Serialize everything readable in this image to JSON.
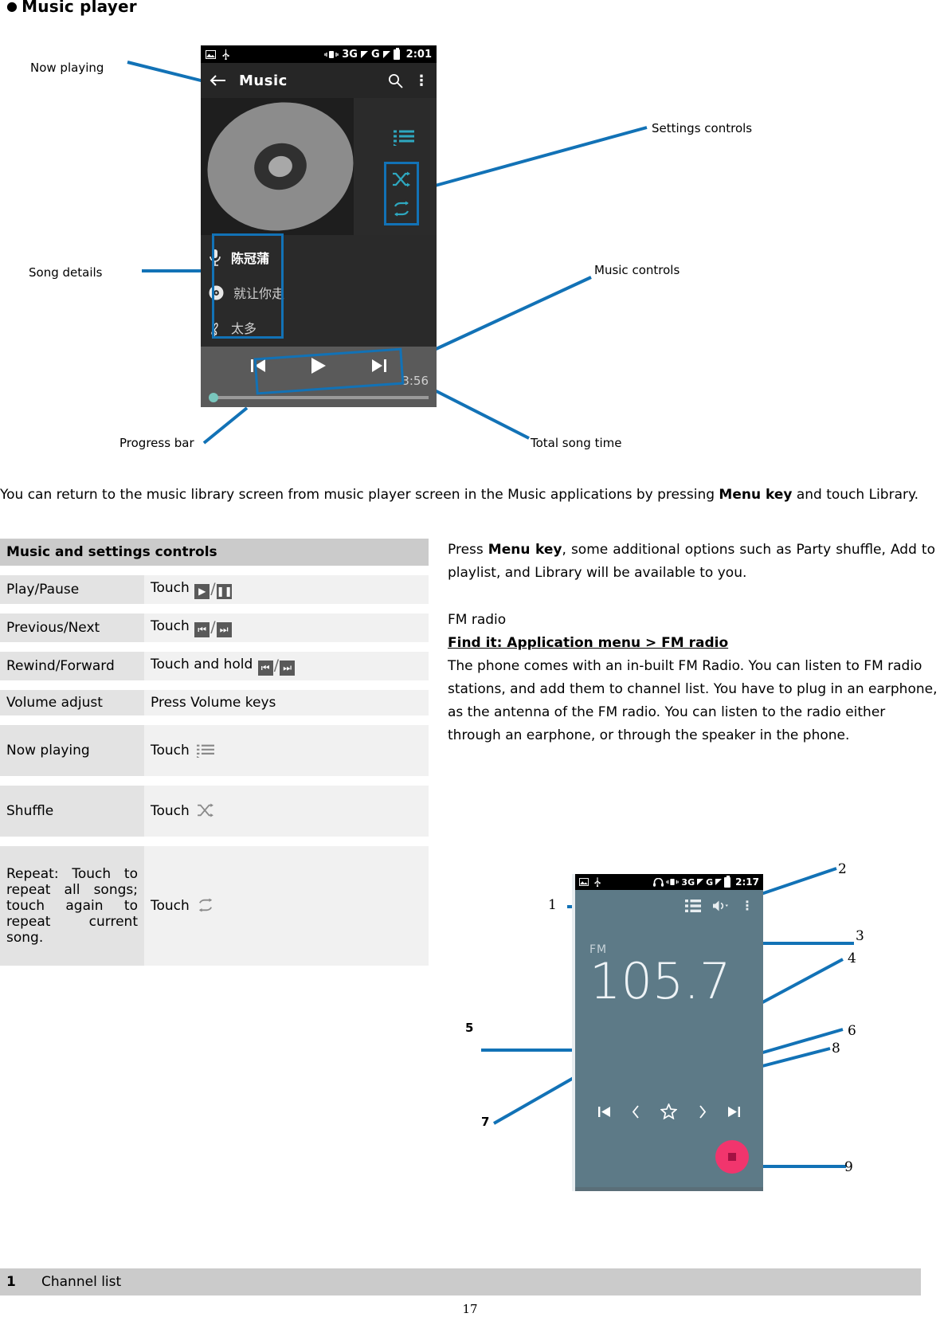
{
  "heading": {
    "bullet": "●",
    "text": "Music player"
  },
  "music_annotations": {
    "now_playing": "Now playing",
    "song_details": "Song details",
    "progress_bar": "Progress bar",
    "settings_controls": "Settings controls",
    "music_controls": "Music controls",
    "total_song_time": "Total song time"
  },
  "music_phone": {
    "status_bar": {
      "time": "2:01",
      "network_3g": "3G",
      "network_g": "G",
      "icons": [
        "screenshot-icon",
        "usb-icon",
        "vibrate-icon",
        "battery-icon"
      ]
    },
    "app_bar": {
      "back": "←",
      "title": "Music",
      "search": "search-icon",
      "overflow": "⋮"
    },
    "side_icons": {
      "now_playing": "now-playing-list-icon",
      "shuffle": "shuffle-icon",
      "repeat": "repeat-icon"
    },
    "song_details": [
      {
        "icon": "microphone-icon",
        "text": "陈冠蒲"
      },
      {
        "icon": "album-disc-icon",
        "text": "就让你走"
      },
      {
        "icon": "treble-clef-icon",
        "text": "太多"
      }
    ],
    "transport": {
      "previous": "previous-icon",
      "play": "play-icon",
      "next": "next-icon",
      "total_time": "3:56"
    }
  },
  "intro_paragraph": {
    "part1": "You can return to the music library screen from music player screen in the Music applications by pressing ",
    "bold": "Menu key",
    "part2": " and touch Library."
  },
  "table": {
    "header": "Music and settings controls",
    "rows": [
      {
        "label": "Play/Pause",
        "action_pre": "Touch ",
        "icons": [
          "play-icon",
          "pause-icon"
        ],
        "sep": "/"
      },
      {
        "label": "Previous/Next",
        "action_pre": "Touch ",
        "icons": [
          "previous-icon",
          "next-icon"
        ],
        "sep": "/"
      },
      {
        "label": "Rewind/Forward",
        "action_pre": "Touch and hold ",
        "icons": [
          "previous-icon",
          "next-icon"
        ],
        "sep": "/"
      },
      {
        "label": "Volume adjust",
        "action_pre": "Press Volume keys",
        "icons": [],
        "sep": ""
      },
      {
        "label": "Now playing",
        "action_pre": "Touch ",
        "icons": [
          "now-playing-list-icon"
        ],
        "sep": ""
      },
      {
        "label": "Shuffle",
        "action_pre": "Touch ",
        "icons": [
          "shuffle-icon"
        ],
        "sep": ""
      },
      {
        "label": "Repeat: Touch to repeat all songs; touch again to repeat current song.",
        "action_pre": "Touch ",
        "icons": [
          "repeat-icon"
        ],
        "sep": ""
      }
    ]
  },
  "right_column": {
    "menu_paragraph_pre": "Press ",
    "menu_paragraph_bold": "Menu key",
    "menu_paragraph_post": ", some additional options such as Party shuffle, Add to playlist, and Library will be available to you.",
    "fm_radio_title": "FM radio",
    "find_it": "Find it: Application menu > FM radio",
    "fm_paragraph": "The phone comes with an in-built FM Radio. You can listen to FM radio stations, and add them to channel list. You have to plug in an earphone, as the antenna of the FM radio. You can listen to the radio either through an earphone, or through the speaker in the phone."
  },
  "fm_phone": {
    "status_bar": {
      "time": "2:17",
      "network_3g": "3G",
      "network_g": "G",
      "icons": [
        "screenshot-icon",
        "usb-icon",
        "headset-icon",
        "vibrate-icon",
        "battery-icon"
      ]
    },
    "top_icons": {
      "channel_list": "channel-list-icon",
      "speaker": "speaker-icon",
      "overflow": "⋮"
    },
    "band_label": "FM",
    "frequency": "105.7",
    "controls": {
      "prev_channel": "previous-channel-icon",
      "tune_down": "tune-down-icon",
      "favorite": "star-icon",
      "tune_up": "tune-up-icon",
      "next_channel": "next-channel-icon"
    },
    "stop_button": "stop-icon"
  },
  "fm_callouts": {
    "n1": "1",
    "n2": "2",
    "n3": "3",
    "n4": "4",
    "n5": "5",
    "n6": "6",
    "n7": "7",
    "n8": "8",
    "n9": "9"
  },
  "footer": {
    "number": "1",
    "label": "Channel list"
  },
  "page_number": "17"
}
